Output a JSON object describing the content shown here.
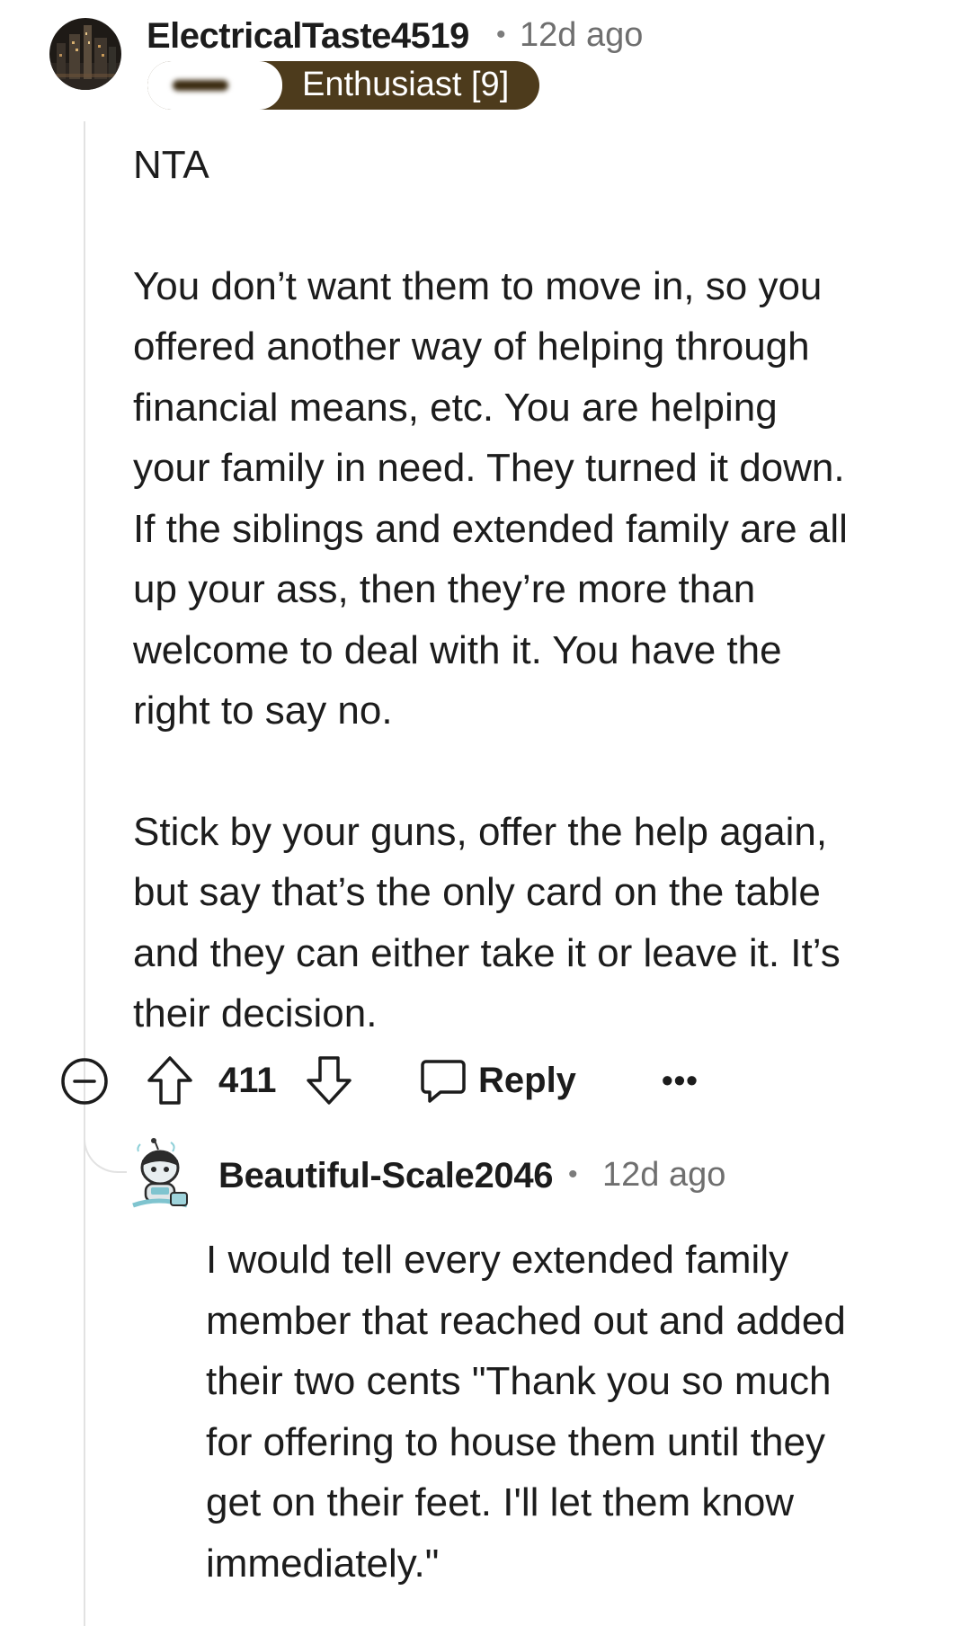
{
  "comment": {
    "username": "ElectricalTaste4519",
    "separator": "•",
    "timestamp": "12d ago",
    "flair": "Enthusiast [9]",
    "body_lines_p1": [
      "NTA"
    ],
    "body_lines_p2": [
      "You don’t want them to move in, so you",
      "offered another way of helping through",
      "financial means, etc. You are helping",
      "your family in need. They turned it down.",
      "If the siblings and extended family are all",
      "up your ass, then they’re more than",
      "welcome to deal with it. You have the",
      "right to say no."
    ],
    "body_lines_p3": [
      "Stick by your guns, offer the help again,",
      "but say that’s the only card on the table",
      "and they can either take it or leave it. It’s",
      "their decision."
    ],
    "vote_count": "411",
    "reply_label": "Reply",
    "more_label": "•••"
  },
  "reply": {
    "username": "Beautiful-Scale2046",
    "separator": "•",
    "timestamp": "12d ago",
    "body_lines": [
      "I would tell every extended family",
      "member that reached out and added",
      "their two cents \"Thank you so much",
      "for offering to house them until they",
      "get on their feet. I'll let them know",
      "immediately.\""
    ]
  },
  "icons": {
    "collapse": "collapse-minus-icon",
    "upvote": "upvote-arrow-icon",
    "downvote": "downvote-arrow-icon",
    "reply": "speech-bubble-icon",
    "more": "more-options-icon"
  },
  "colors": {
    "flair_background": "#4d3b1c",
    "text": "#1c1c1c",
    "meta_text": "#6f6f6f",
    "thread_line": "#e2e2e2"
  }
}
